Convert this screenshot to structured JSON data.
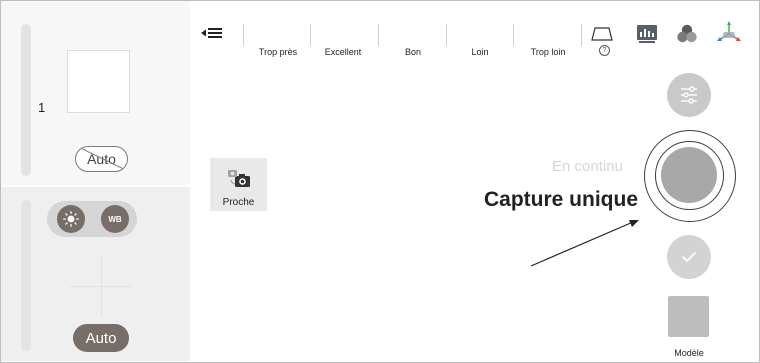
{
  "left_panel": {
    "count": "1",
    "auto_top": "Auto",
    "wb_label": "WB",
    "auto_bottom": "Auto"
  },
  "toolbar": {
    "distances": [
      "Trop près",
      "Excellent",
      "Bon",
      "Loin",
      "Trop loin"
    ],
    "help_symbol": "?",
    "icons": [
      "menu-icon",
      "frame-icon",
      "histogram-icon",
      "color-channels-icon",
      "axes-icon"
    ]
  },
  "center": {
    "proche_label": "Proche",
    "mode_label": "En continu",
    "capture_label": "Capture unique"
  },
  "right_panel": {
    "model_label": "Modèle"
  },
  "colors": {
    "accent_dark": "#776e6a",
    "shutter_core": "#a8a8a8",
    "axis_red": "#e2463b",
    "axis_green": "#3cae4a",
    "axis_blue": "#3b7de0"
  }
}
